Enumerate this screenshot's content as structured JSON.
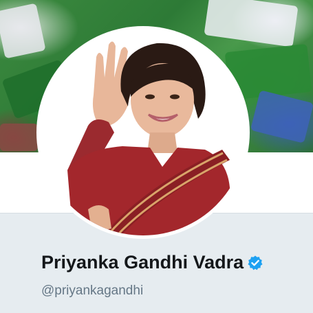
{
  "profile": {
    "display_name": "Priyanka Gandhi Vadra",
    "handle": "@priyankagandhi",
    "verified": true
  },
  "icons": {
    "verified": "verified-badge-icon"
  },
  "colors": {
    "page_background": "#e6ecf0",
    "name_text": "#14171a",
    "handle_text": "#657786",
    "verified_badge": "#1da1f2"
  }
}
